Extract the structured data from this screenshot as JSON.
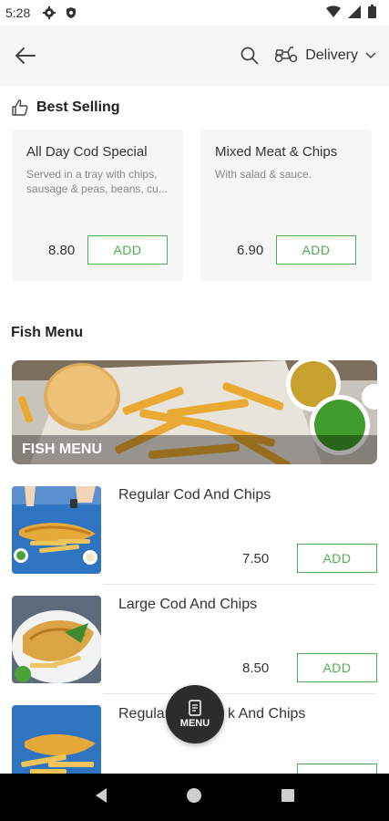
{
  "status_bar": {
    "time": "5:28"
  },
  "app_bar": {
    "delivery_label": "Delivery"
  },
  "best_selling": {
    "heading": "Best Selling",
    "cards": [
      {
        "title": "All Day Cod Special",
        "description": "Served in a tray with chips, sausage & peas, beans, cu...",
        "price": "8.80",
        "add_label": "ADD"
      },
      {
        "title": "Mixed Meat & Chips",
        "description": "With salad & sauce.",
        "price": "6.90",
        "add_label": "ADD"
      }
    ]
  },
  "fish_menu": {
    "heading": "Fish Menu",
    "banner_label": "FISH MENU",
    "items": [
      {
        "name": "Regular Cod And Chips",
        "price": "7.50",
        "add_label": "ADD"
      },
      {
        "name": "Large Cod And Chips",
        "price": "8.50",
        "add_label": "ADD"
      },
      {
        "name": "Regular",
        "name_tail": "k And Chips",
        "price": "",
        "add_label": ""
      }
    ]
  },
  "fab": {
    "label": "MENU"
  },
  "colors": {
    "accent_green": "#4caf50",
    "fab_bg": "#2c2c2c",
    "card_bg": "#f6f6f6"
  }
}
